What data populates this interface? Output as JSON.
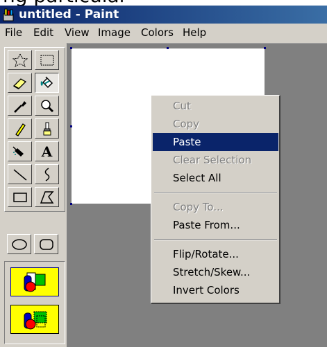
{
  "window": {
    "title": "untitled - Paint",
    "partial_text_top": "ng particular"
  },
  "menubar": {
    "items": [
      "File",
      "Edit",
      "View",
      "Image",
      "Colors",
      "Help"
    ]
  },
  "toolbox": {
    "tools": [
      {
        "name": "free-form-select-tool",
        "icon": "free-form-select-icon"
      },
      {
        "name": "rectangle-select-tool",
        "icon": "rectangle-select-icon"
      },
      {
        "name": "eraser-tool",
        "icon": "eraser-icon"
      },
      {
        "name": "fill-tool",
        "icon": "paint-bucket-icon"
      },
      {
        "name": "pick-color-tool",
        "icon": "eyedropper-icon"
      },
      {
        "name": "magnifier-tool",
        "icon": "magnifier-icon"
      },
      {
        "name": "pencil-tool",
        "icon": "pencil-icon"
      },
      {
        "name": "brush-tool",
        "icon": "brush-icon"
      },
      {
        "name": "airbrush-tool",
        "icon": "airbrush-icon"
      },
      {
        "name": "text-tool",
        "icon": "text-icon",
        "glyph": "A"
      },
      {
        "name": "line-tool",
        "icon": "line-icon"
      },
      {
        "name": "curve-tool",
        "icon": "curve-icon"
      },
      {
        "name": "rectangle-tool",
        "icon": "rectangle-icon"
      },
      {
        "name": "polygon-tool",
        "icon": "polygon-icon"
      },
      {
        "name": "ellipse-tool",
        "icon": "ellipse-icon"
      },
      {
        "name": "rounded-rectangle-tool",
        "icon": "rounded-rectangle-icon"
      }
    ],
    "selected_tool": "fill-tool",
    "transparency_options": [
      "opaque-background-icon",
      "transparent-background-icon"
    ]
  },
  "context_menu": {
    "items": [
      {
        "label": "Cut",
        "state": "disabled"
      },
      {
        "label": "Copy",
        "state": "disabled"
      },
      {
        "label": "Paste",
        "state": "highlighted"
      },
      {
        "label": "Clear Selection",
        "state": "disabled"
      },
      {
        "label": "Select All",
        "state": "enabled"
      },
      {
        "label": "Copy To...",
        "state": "disabled"
      },
      {
        "label": "Paste From...",
        "state": "enabled"
      },
      {
        "label": "Flip/Rotate...",
        "state": "enabled"
      },
      {
        "label": "Stretch/Skew...",
        "state": "enabled"
      },
      {
        "label": "Invert Colors",
        "state": "enabled"
      }
    ]
  },
  "colors": {
    "titlebar": "#0a246a",
    "menu_highlight": "#0a246a",
    "face": "#d4d0c8",
    "workspace": "#808080",
    "canvas": "#ffffff",
    "option_bg": "#ffff00"
  }
}
